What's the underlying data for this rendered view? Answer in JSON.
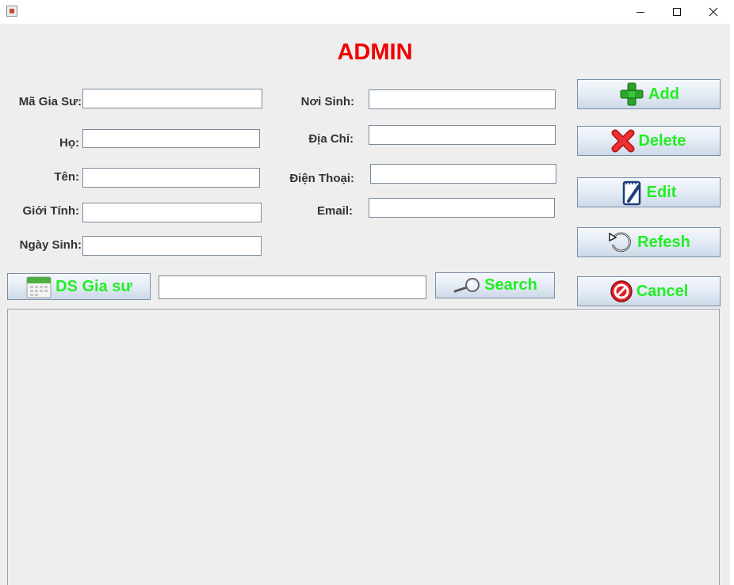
{
  "window": {
    "minimize_icon": "minimize-icon",
    "maximize_icon": "maximize-icon",
    "close_icon": "close-icon"
  },
  "heading": "ADMIN",
  "form": {
    "ma_gia_su": {
      "label": "Mã Gia Sư:",
      "value": ""
    },
    "ho": {
      "label": "Họ:",
      "value": ""
    },
    "ten": {
      "label": "Tên:",
      "value": ""
    },
    "gioi_tinh": {
      "label": "Giới Tính:",
      "value": ""
    },
    "ngay_sinh": {
      "label": "Ngày Sinh:",
      "value": ""
    },
    "noi_sinh": {
      "label": "Nơi Sinh:",
      "value": ""
    },
    "dia_chi": {
      "label": "Địa Chỉ:",
      "value": ""
    },
    "dien_thoai": {
      "label": "Điện Thoại:",
      "value": ""
    },
    "email": {
      "label": "Email:",
      "value": ""
    }
  },
  "actions": {
    "add": {
      "label": "Add",
      "icon": "plus-icon"
    },
    "delete": {
      "label": "Delete",
      "icon": "x-icon"
    },
    "edit": {
      "label": "Edit",
      "icon": "notepad-icon"
    },
    "refresh": {
      "label": "Refesh",
      "icon": "refresh-icon"
    },
    "cancel": {
      "label": "Cancel",
      "icon": "cancel-icon"
    }
  },
  "list_button": {
    "label": "DS Gia sư",
    "icon": "calendar-icon"
  },
  "search": {
    "value": "",
    "button_label": "Search",
    "icon": "magnifier-icon"
  },
  "colors": {
    "heading": "#f00000",
    "button_text": "#22ee22",
    "label_text": "#333333",
    "background": "#eeeeee"
  }
}
